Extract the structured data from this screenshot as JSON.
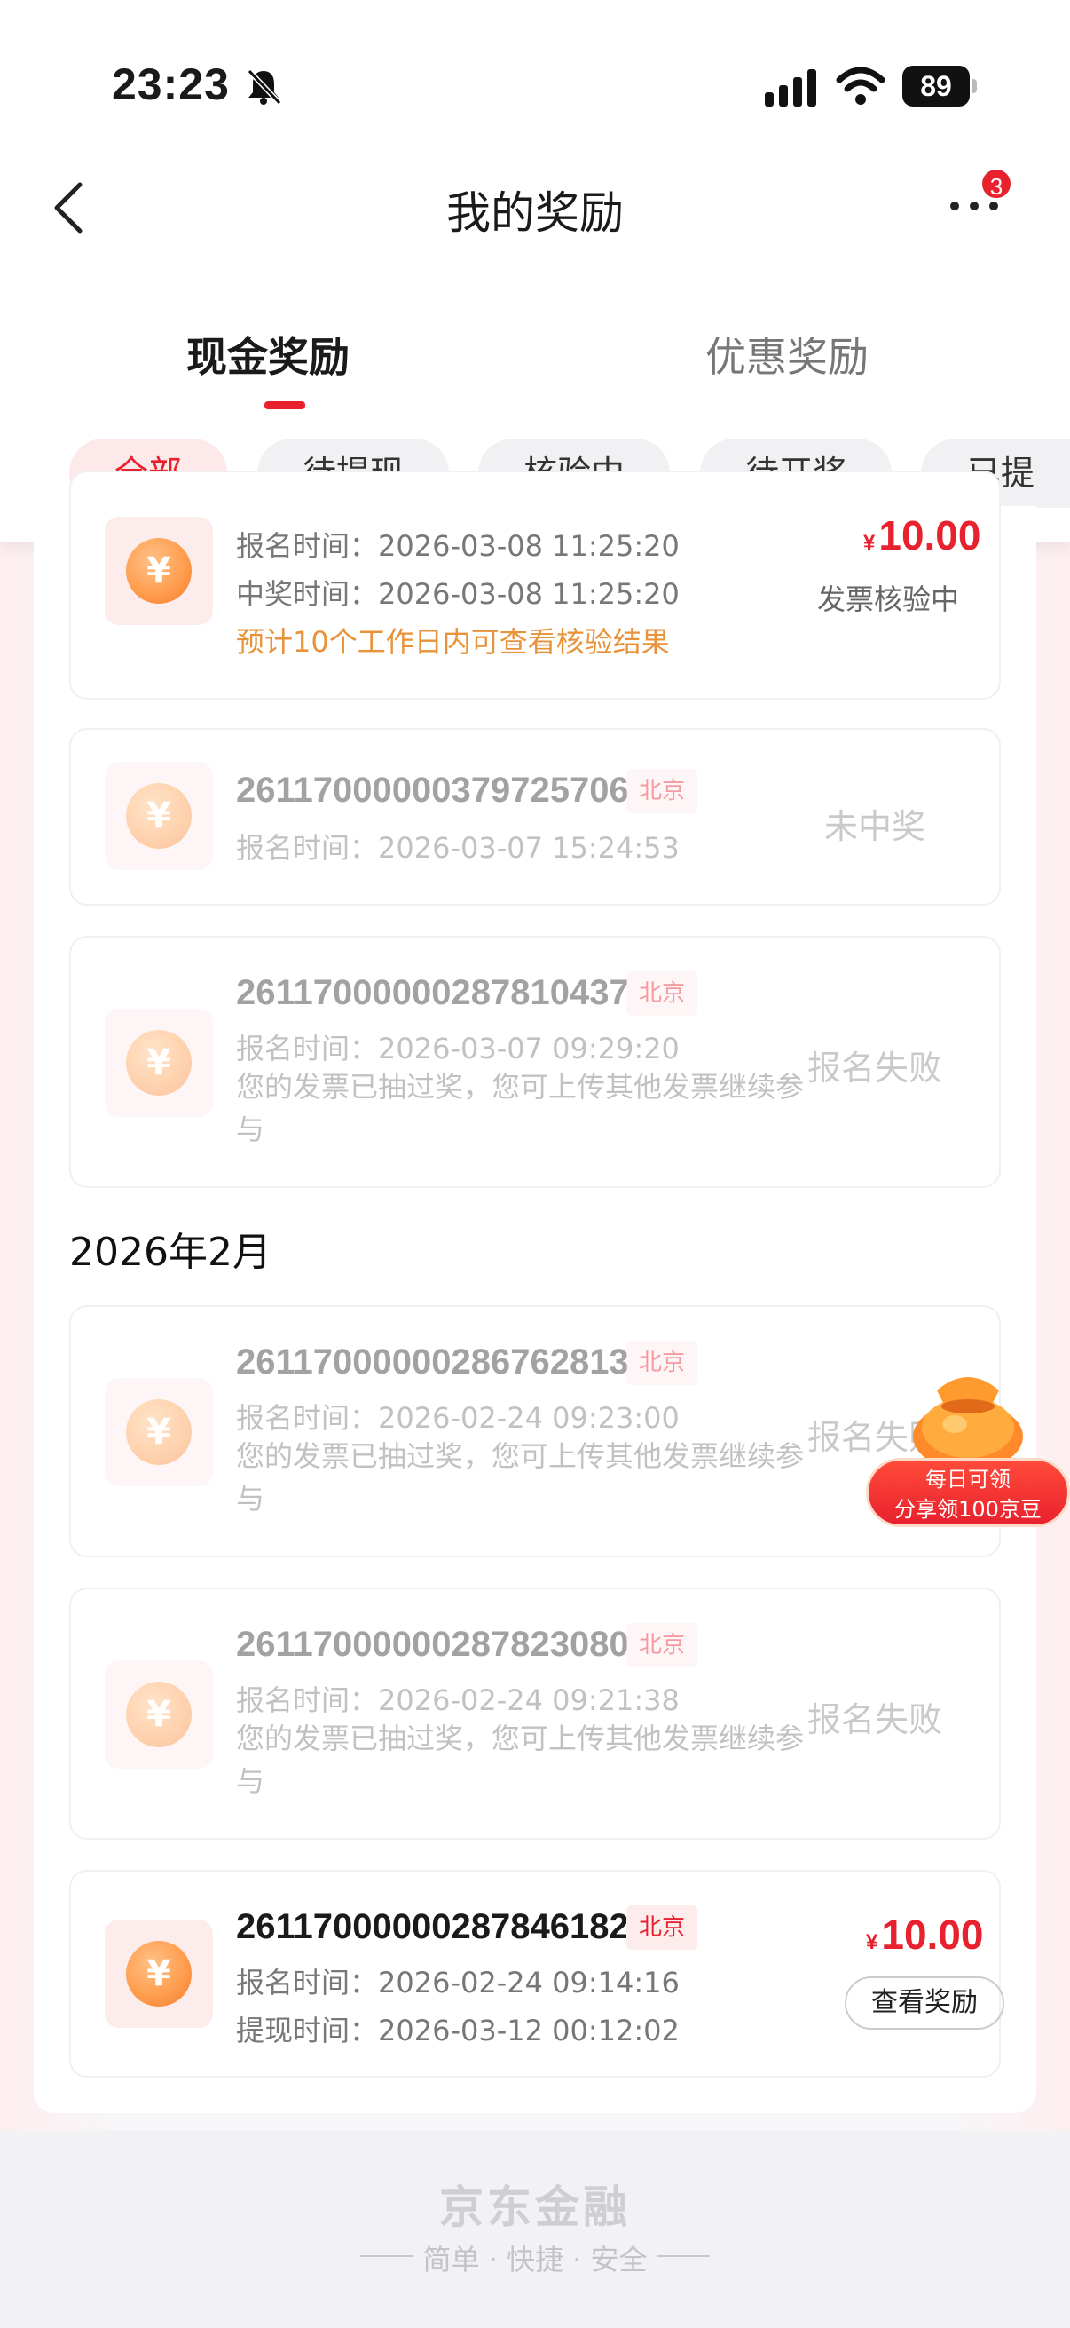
{
  "status_bar": {
    "time": "23:23",
    "battery": "89"
  },
  "header": {
    "title": "我的奖励",
    "more_badge": "3"
  },
  "tabs": [
    {
      "label": "现金奖励"
    },
    {
      "label": "优惠奖励"
    }
  ],
  "filters": [
    "全部",
    "待提现",
    "核验中",
    "待开奖",
    "已提"
  ],
  "records": [
    {
      "report_time": "报名时间：2026-03-08 11:25:20",
      "win_time": "中奖时间：2026-03-08 11:25:20",
      "notice": "预计10个工作日内可查看核验结果",
      "currency": "¥",
      "amount": "10.00",
      "status": "发票核验中"
    },
    {
      "id": "2611700000037972570​6",
      "city": "北京",
      "report_time": "报名时间：2026-03-07 15:24:53",
      "status": "未中奖"
    },
    {
      "id": "26117000000287810437",
      "city": "北京",
      "report_time": "报名时间：2026-03-07 09:29:20",
      "note": "您的发票已抽过奖，您可上传其他发票继续参与",
      "status": "报名失败"
    }
  ],
  "month_heading": "2026年2月",
  "records_feb": [
    {
      "id": "26117000000286762813",
      "city": "北京",
      "report_time": "报名时间：2026-02-24 09:23:00",
      "note": "您的发票已抽过奖，您可上传其他发票继续参与",
      "status": "报名失败"
    },
    {
      "id": "26117000000287823080",
      "city": "北京",
      "report_time": "报名时间：2026-02-24 09:21:38",
      "note": "您的发票已抽过奖，您可上传其他发票继续参与",
      "status": "报名失败"
    },
    {
      "id": "26117000000287846182",
      "city": "北京",
      "report_time": "报名时间：2026-02-24 09:14:16",
      "withdraw_time": "提现时间：2026-03-12 00:12:02",
      "currency": "¥",
      "amount": "10.00",
      "button": "查看奖励"
    }
  ],
  "promo": {
    "line1": "每日可领",
    "line2": "分享领100京豆"
  },
  "footer": {
    "brand": "京东金融",
    "slogan": "简单 · 快捷 · 安全"
  },
  "colors": {
    "accent": "#e8212e",
    "notice": "#e8923a"
  },
  "icons": {
    "coin": "yuan-coin-icon"
  }
}
